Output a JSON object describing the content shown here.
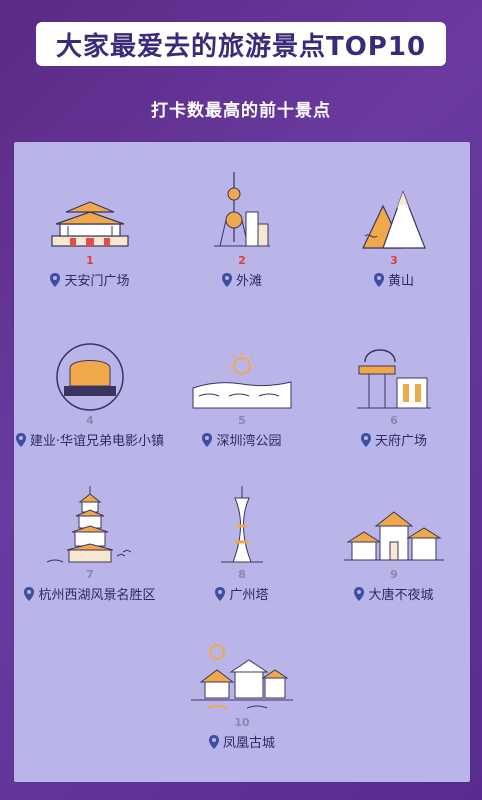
{
  "title": "大家最爱去的旅游景点TOP10",
  "subtitle": "打卡数最高的前十景点",
  "spots": [
    {
      "rank": "1",
      "name": "天安门广场",
      "icon": "tiananmen-icon"
    },
    {
      "rank": "2",
      "name": "外滩",
      "icon": "oriental-pearl-tower-icon"
    },
    {
      "rank": "3",
      "name": "黄山",
      "icon": "mountain-icon"
    },
    {
      "rank": "4",
      "name": "建业·华谊兄弟电影小镇",
      "icon": "film-town-icon"
    },
    {
      "rank": "5",
      "name": "深圳湾公园",
      "icon": "sun-sea-icon"
    },
    {
      "rank": "6",
      "name": "天府广场",
      "icon": "tianfu-square-icon"
    },
    {
      "rank": "7",
      "name": "杭州西湖风景名胜区",
      "icon": "pagoda-icon"
    },
    {
      "rank": "8",
      "name": "广州塔",
      "icon": "canton-tower-icon"
    },
    {
      "rank": "9",
      "name": "大唐不夜城",
      "icon": "tang-city-icon"
    },
    {
      "rank": "10",
      "name": "凤凰古城",
      "icon": "fenghuang-town-icon"
    }
  ],
  "colors": {
    "background": "#5b2a86",
    "panel": "#b9b5e8",
    "title_text": "#3b2a7a",
    "rank_top": "#e23b3b",
    "rank_other": "#8a88b0",
    "icon_orange": "#f0a94a",
    "icon_outline": "#3a3560"
  }
}
